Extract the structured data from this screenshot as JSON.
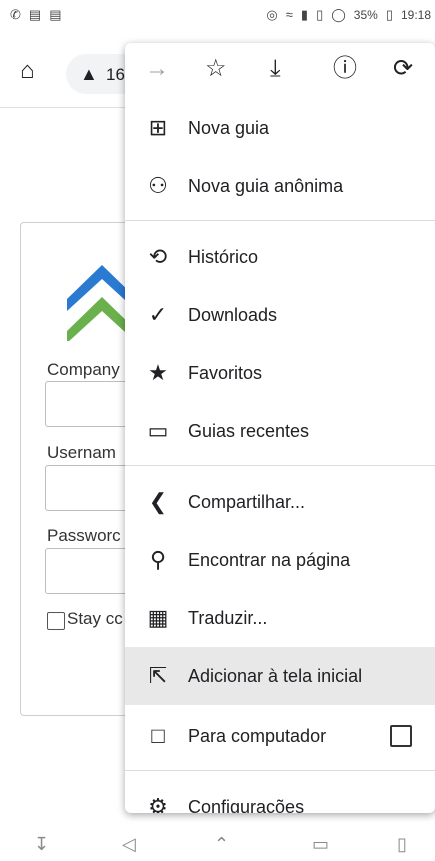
{
  "status_bar": {
    "battery": "35%",
    "time": "19:18"
  },
  "toolbar": {
    "url_fragment": "16",
    "home_icon": "home-icon",
    "warning_icon": "warning-icon"
  },
  "page": {
    "logo_colors": {
      "top": "#2a7ad2",
      "bottom": "#6ab04c"
    },
    "company_label": "Company",
    "username_label": "Usernam",
    "password_label": "Passworc",
    "stay_label": "Stay cc"
  },
  "menu": {
    "top_icons": [
      "forward-icon",
      "bookmark-star-icon",
      "download-icon",
      "info-icon",
      "reload-icon"
    ],
    "items": [
      {
        "label": "Nova guia",
        "icon": "new-tab-icon"
      },
      {
        "label": "Nova guia anônima",
        "icon": "incognito-icon"
      },
      {
        "label": "Histórico",
        "icon": "history-icon"
      },
      {
        "label": "Downloads",
        "icon": "downloads-icon"
      },
      {
        "label": "Favoritos",
        "icon": "star-icon"
      },
      {
        "label": "Guias recentes",
        "icon": "devices-icon"
      },
      {
        "label": "Compartilhar...",
        "icon": "share-icon"
      },
      {
        "label": "Encontrar na página",
        "icon": "find-in-page-icon"
      },
      {
        "label": "Traduzir...",
        "icon": "translate-icon"
      },
      {
        "label": "Adicionar à tela inicial",
        "icon": "add-to-home-icon"
      },
      {
        "label": "Para computador",
        "icon": "desktop-icon"
      },
      {
        "label": "Configurações",
        "icon": "settings-icon"
      }
    ]
  },
  "nav_bar": {
    "icons": [
      "download-arrow-icon",
      "back-icon",
      "home-icon",
      "recents-icon",
      "screenshot-icon"
    ]
  }
}
